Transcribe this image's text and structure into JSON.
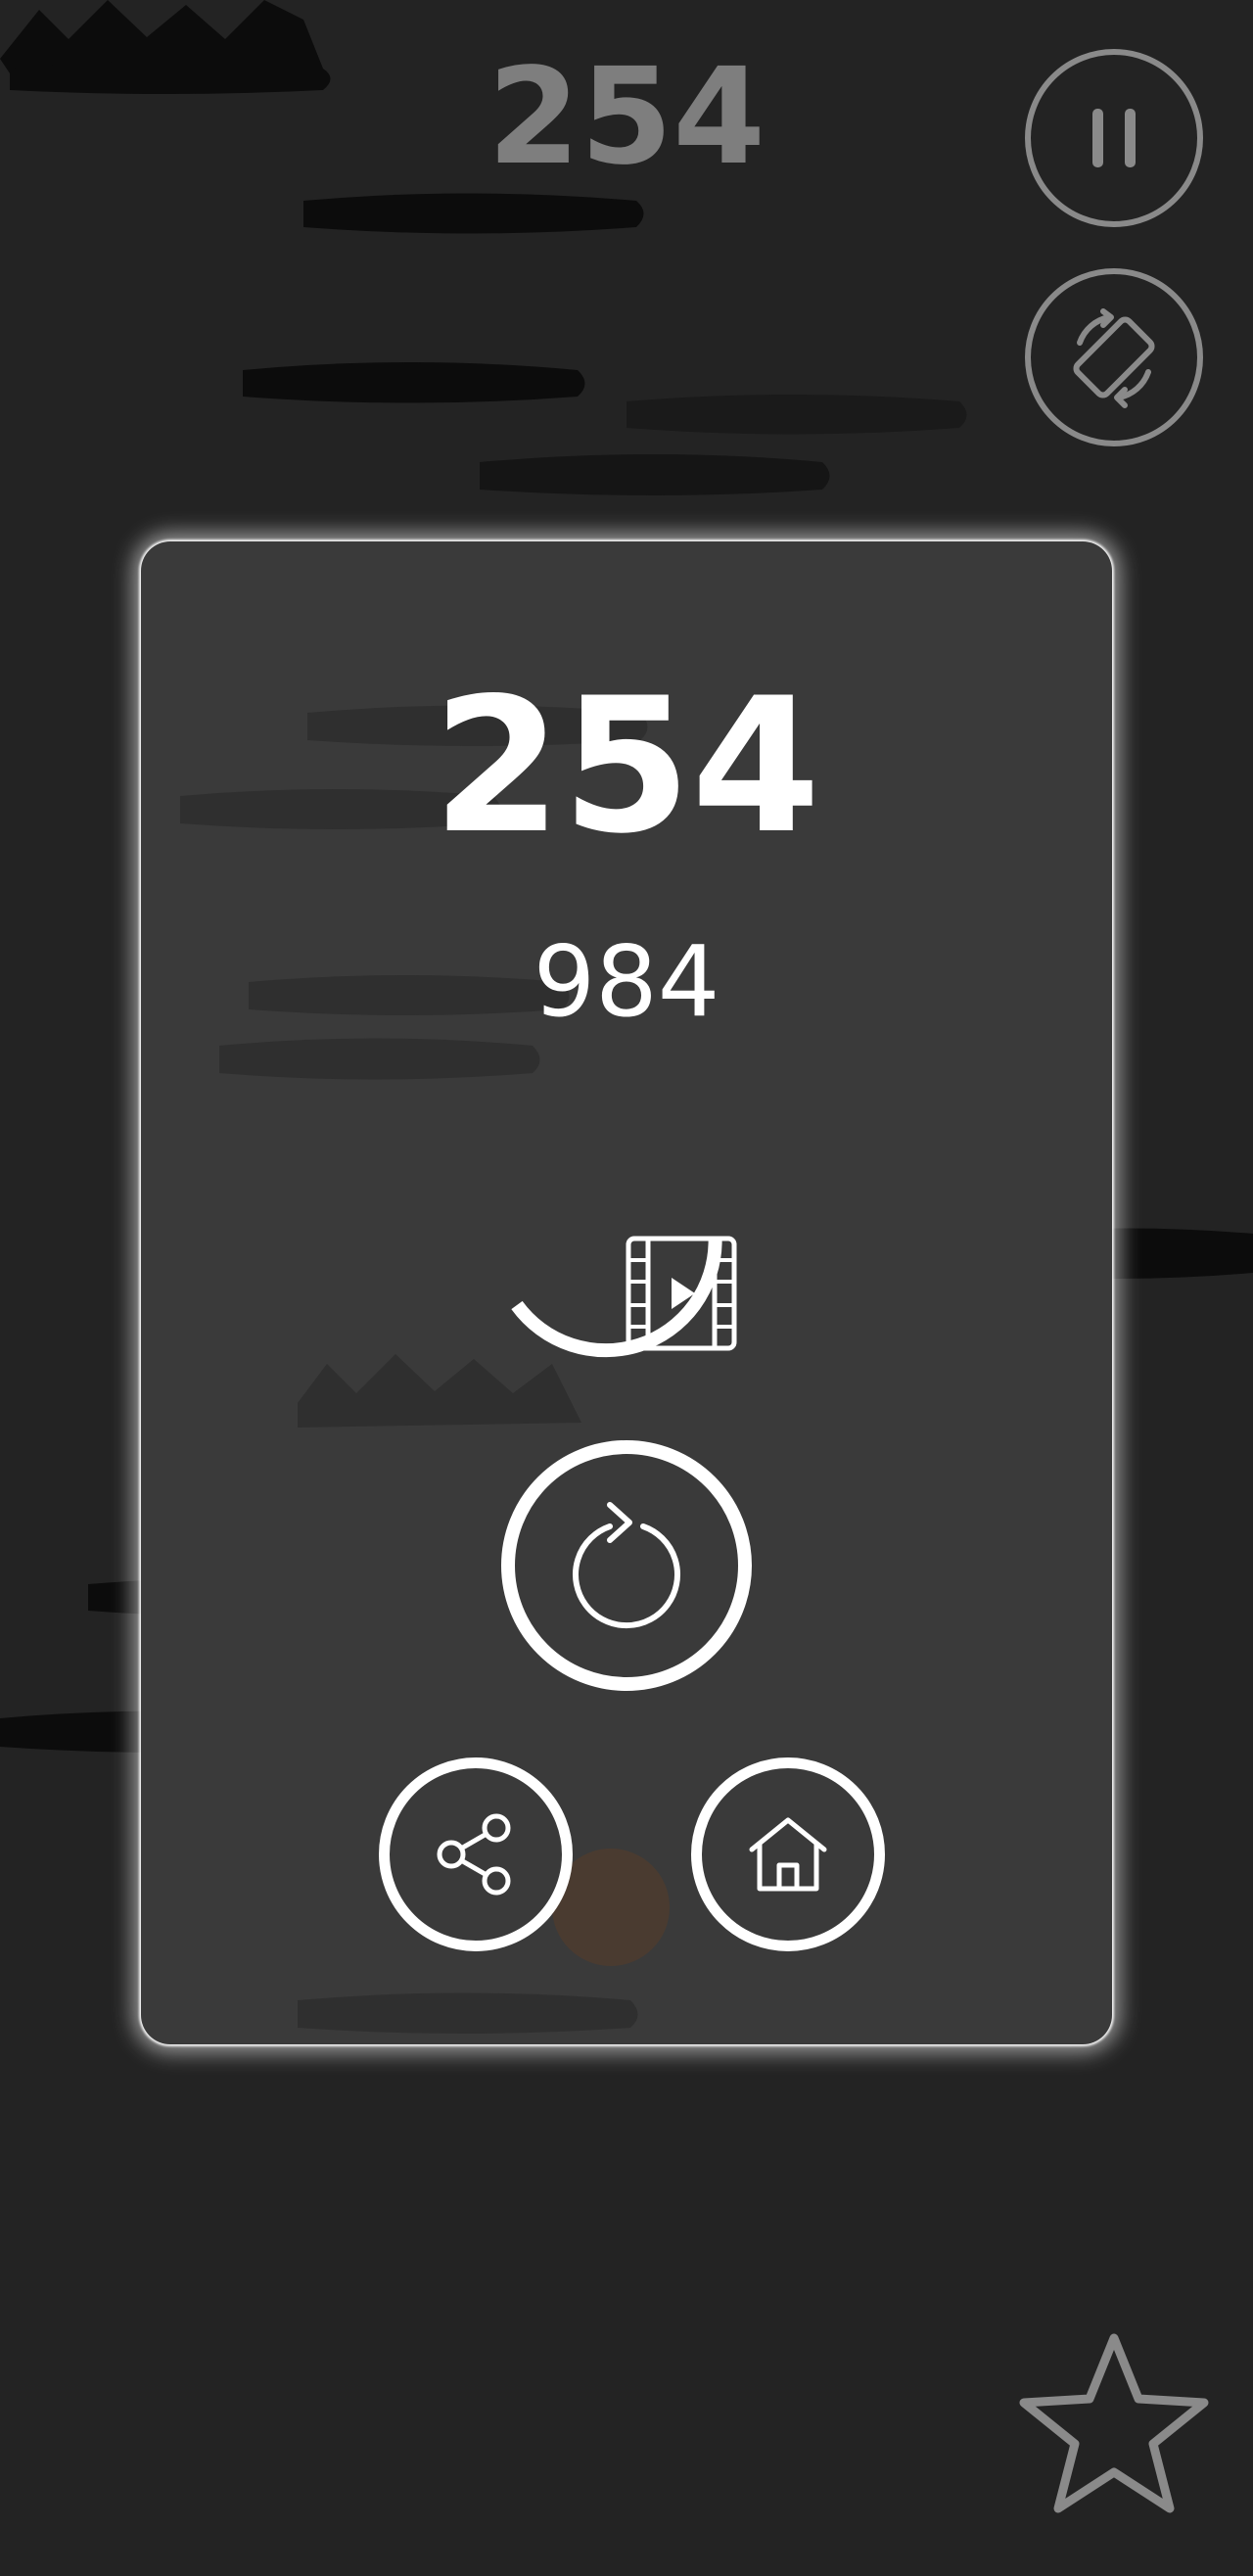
{
  "hud": {
    "current_score": "254",
    "pause_icon": "pause-icon",
    "rotate_icon": "rotate-screen-icon"
  },
  "result_panel": {
    "score": "254",
    "best_score": "984",
    "video_icon": "video-reward-icon",
    "video_timer_progress": 0.4,
    "restart_icon": "restart-icon",
    "share_icon": "share-icon",
    "home_icon": "home-icon"
  },
  "footer": {
    "star_icon": "star-icon"
  },
  "colors": {
    "background": "#232323",
    "panel": "#3a3a3a",
    "hud_text": "#7e7e7e",
    "accent": "#ffffff",
    "silhouette": "#0c0c0c"
  }
}
